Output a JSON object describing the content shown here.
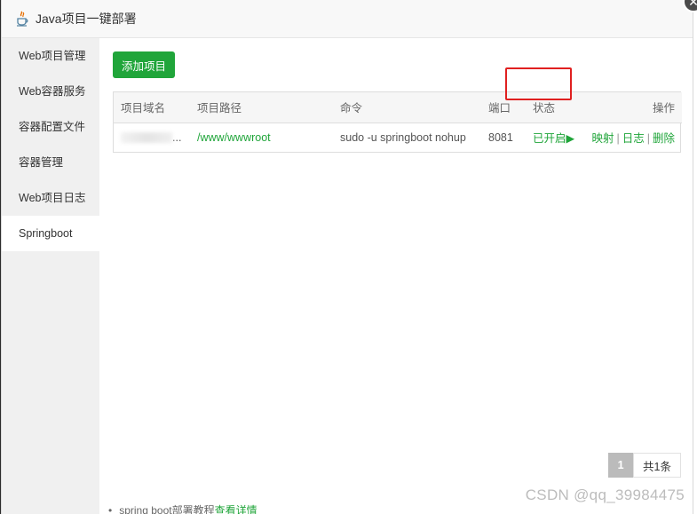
{
  "window": {
    "title": "Java项目一键部署",
    "close_glyph": "✕"
  },
  "sidebar": {
    "items": [
      {
        "label": "Web项目管理"
      },
      {
        "label": "Web容器服务"
      },
      {
        "label": "容器配置文件"
      },
      {
        "label": "容器管理"
      },
      {
        "label": "Web项目日志"
      },
      {
        "label": "Springboot"
      }
    ],
    "active_index": 5
  },
  "toolbar": {
    "add_label": "添加项目"
  },
  "table": {
    "headers": {
      "domain": "项目域名",
      "path": "项目路径",
      "command": "命令",
      "port": "端口",
      "status": "状态",
      "actions": "操作"
    },
    "rows": [
      {
        "domain_suffix": "...",
        "path": "/www/wwwroot",
        "command": "sudo -u springboot nohup",
        "port": "8081",
        "status": "已开启▶",
        "actions": {
          "map": "映射",
          "log": "日志",
          "delete": "删除",
          "sep": "|"
        }
      }
    ]
  },
  "pagination": {
    "current": "1",
    "total": "共1条"
  },
  "footer": {
    "note": "spring boot部署教程",
    "link": "查看详情"
  },
  "watermark": "CSDN @qq_39984475",
  "colors": {
    "accent": "#20a53a",
    "highlight": "#e02020"
  },
  "icons": {
    "title_icon": "java-icon",
    "close": "close-icon"
  }
}
